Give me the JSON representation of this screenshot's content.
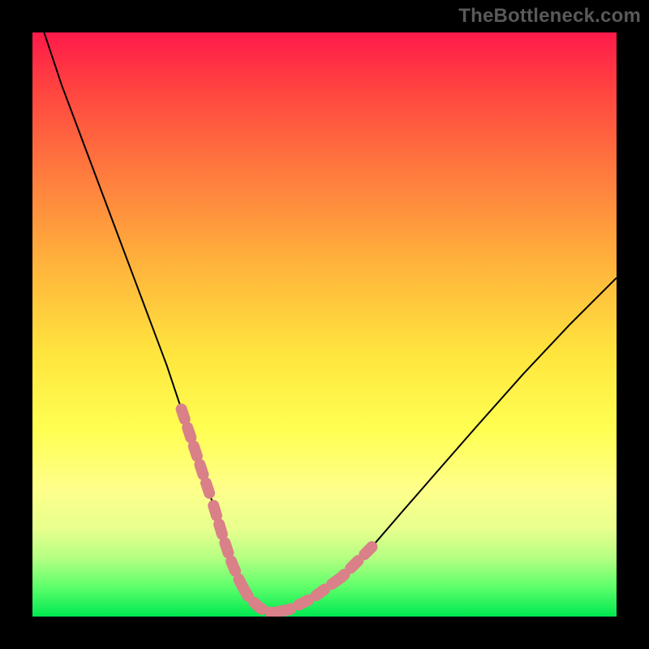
{
  "watermark": "TheBottleneck.com",
  "chart_data": {
    "type": "line",
    "title": "",
    "xlabel": "",
    "ylabel": "",
    "xlim": [
      0,
      100
    ],
    "ylim": [
      0,
      100
    ],
    "grid": false,
    "legend": false,
    "series": [
      {
        "name": "bottleneck-curve",
        "color": "#000000",
        "stroke_width": 2,
        "x": [
          2,
          5,
          8,
          11,
          14,
          17,
          20,
          23,
          25,
          27,
          29,
          31,
          32.5,
          34,
          35.5,
          37,
          39,
          41,
          44,
          48,
          53,
          58,
          63,
          69,
          76,
          84,
          92,
          100
        ],
        "y": [
          100,
          91,
          83,
          75,
          67,
          59,
          51,
          43,
          37,
          31,
          25,
          19,
          14,
          9.5,
          6,
          3.3,
          1.4,
          0.6,
          1.2,
          3.2,
          6.8,
          11.8,
          17.6,
          24.5,
          32.5,
          41.5,
          50,
          58
        ]
      }
    ],
    "annotations": {
      "dotted_band": {
        "description": "pink dotted overlay along lower part of the V-curve (marker band)",
        "color": "#d98088",
        "segments": [
          {
            "x": [
              25.5,
              30.5
            ],
            "note": "upper-left dotted segment"
          },
          {
            "x": [
              31.0,
              36.0
            ],
            "note": "lower-left dotted segment"
          },
          {
            "x": [
              36.0,
              42.5
            ],
            "note": "bottom dotted segment"
          },
          {
            "x": [
              42.5,
              52.0
            ],
            "note": "lower-right dotted segment"
          },
          {
            "x": [
              52.0,
              58.5
            ],
            "note": "upper-right dotted segment"
          }
        ]
      }
    },
    "background_gradient": {
      "direction": "top-to-bottom",
      "stops": [
        {
          "pos": 0.0,
          "color": "#ff1a4a"
        },
        {
          "pos": 0.1,
          "color": "#ff4540"
        },
        {
          "pos": 0.25,
          "color": "#ff7e3e"
        },
        {
          "pos": 0.4,
          "color": "#ffb43c"
        },
        {
          "pos": 0.55,
          "color": "#ffe53e"
        },
        {
          "pos": 0.68,
          "color": "#ffff52"
        },
        {
          "pos": 0.78,
          "color": "#ffff8a"
        },
        {
          "pos": 0.85,
          "color": "#e8ff8e"
        },
        {
          "pos": 0.9,
          "color": "#b4ff82"
        },
        {
          "pos": 0.95,
          "color": "#5cff6a"
        },
        {
          "pos": 1.0,
          "color": "#00e850"
        }
      ]
    }
  }
}
